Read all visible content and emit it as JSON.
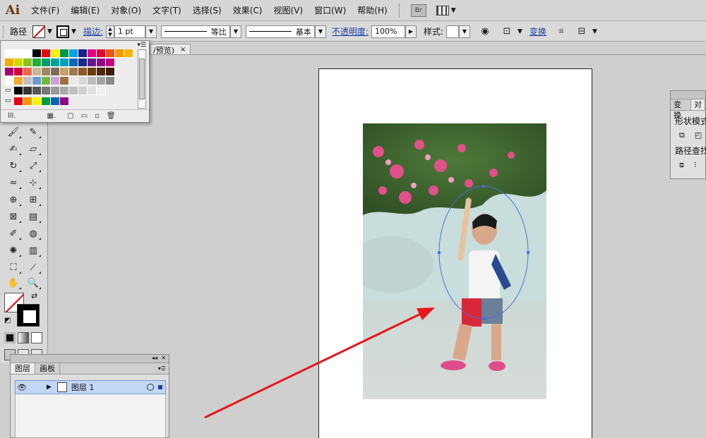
{
  "app": {
    "logo": "Ai"
  },
  "menu": [
    "文件(F)",
    "编辑(E)",
    "对象(O)",
    "文字(T)",
    "选择(S)",
    "效果(C)",
    "视图(V)",
    "窗口(W)",
    "帮助(H)"
  ],
  "bridge_label": "Br",
  "control": {
    "selection_type": "路径",
    "stroke_link": "描边:",
    "stroke_weight": "1 pt",
    "variable_width": "等比",
    "brush": "基本",
    "opacity_link": "不透明度:",
    "opacity_value": "100%",
    "style_label": "样式:",
    "transform_link": "变换"
  },
  "doc_tab": {
    "title": "/预览)",
    "close": "×"
  },
  "swatch_colors": [
    [
      "#ffffff",
      "#000000",
      "#e60012",
      "#fff100",
      "#009944",
      "#00a0e9",
      "#1d2088",
      "#e4007f",
      "#e60033",
      "#ea5514",
      "#f39800",
      "#f8b500"
    ],
    [
      "#f6ab00",
      "#cfdb00",
      "#8fc31f",
      "#22ac38",
      "#009b6b",
      "#00a29a",
      "#00a0c1",
      "#0068b7",
      "#172a88",
      "#601986",
      "#920783",
      "#be0081"
    ],
    [
      "#a4006e",
      "#d7003a",
      "#ec6941",
      "#c9b796",
      "#a08762",
      "#7e6b5a",
      "#c7a06a",
      "#9a7b4f",
      "#8a5a2b",
      "#6b3d12",
      "#4e2a0c",
      "#3a1d08"
    ],
    [
      "#ffffff",
      "#f0a830",
      "#bfbfbf",
      "#6a9ad0",
      "#6dbb3a",
      "#c9a0e0",
      "#a07040",
      "#e8e8e8",
      "#d9d9d9",
      "#bdbdbd",
      "#a3a3a3",
      "#898989"
    ],
    [
      "#000000",
      "#333333",
      "#555555",
      "#777777",
      "#999999",
      "#aaaaaa",
      "#c0c0c0",
      "#d0d0d0",
      "#e0e0e0",
      "#f0f0f0"
    ],
    [
      "#e60012",
      "#f39800",
      "#fff100",
      "#009944",
      "#0068b7",
      "#920783"
    ]
  ],
  "layers": {
    "tabs": [
      "图层",
      "画板"
    ],
    "rows": [
      {
        "name": "图层 1"
      }
    ]
  },
  "right_panel": {
    "tabs": [
      "变换",
      "对"
    ],
    "shape_modes": "形状模式",
    "pathfinder": "路径查找"
  },
  "colors": {
    "arrow": "#e8151a",
    "ellipse": "#4a6fd6",
    "layer_highlight": "#c2d7f5"
  }
}
